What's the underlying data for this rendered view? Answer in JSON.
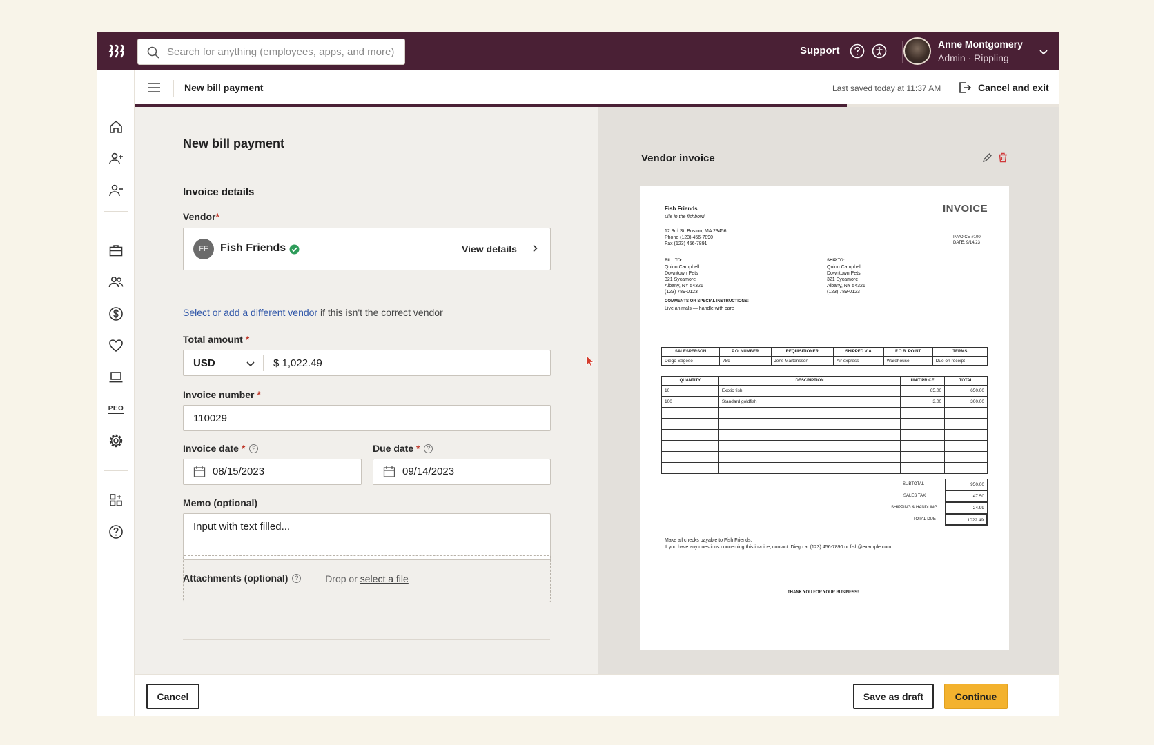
{
  "search": {
    "placeholder": "Search for anything (employees, apps, and more)"
  },
  "topbar": {
    "support_label": "Support",
    "user_name": "Anne Montgomery",
    "user_role": "Admin · Rippling"
  },
  "subheader": {
    "title": "New bill payment",
    "last_saved": "Last saved today at 11:37 AM",
    "cancel_exit": "Cancel and exit",
    "progress": 0.77
  },
  "form": {
    "title": "New bill payment",
    "section_title": "Invoice details",
    "vendor_label": "Vendor",
    "vendor_initials": "FF",
    "vendor_name": "Fish Friends",
    "view_details": "View details",
    "vendor_note_link": "Select or add a different vendor",
    "vendor_note_rest": " if this isn't the correct vendor",
    "total_label": "Total amount",
    "currency": "USD",
    "amount": "$  1,022.49",
    "invoice_number_label": "Invoice number",
    "invoice_number": "110029",
    "invoice_date_label": "Invoice date",
    "invoice_date": "08/15/2023",
    "due_date_label": "Due date",
    "due_date": "09/14/2023",
    "memo_label": "Memo (optional)",
    "memo_value": "Input with text filled...",
    "attachments_label": "Attachments (optional)",
    "drop_text": "Drop or ",
    "select_file": "select a file"
  },
  "invoice_panel": {
    "title": "Vendor invoice",
    "doc": {
      "company": "Fish Friends",
      "tagline": "Life in the fishbowl",
      "address": "12 3rd St, Boston, MA 23456",
      "phone": "Phone (123) 456-7890",
      "fax": "Fax (123) 456-7891",
      "title": "INVOICE",
      "invoice_no": "INVOICE #100",
      "date": "DATE: 9/14/23",
      "bill_to_label": "BILL TO:",
      "bill_to": [
        "Quinn Campbell",
        "Downtown Pets",
        "321 Sycamore",
        "Albany, NY 54321",
        "(123) 789-0123"
      ],
      "ship_to_label": "SHIP TO:",
      "ship_to": [
        "Quinn Campbell",
        "Downtown Pets",
        "321 Sycamore",
        "Albany, NY 54321",
        "(123) 789-0123"
      ],
      "comments_label": "COMMENTS OR SPECIAL INSTRUCTIONS:",
      "comments": "Live animals — handle with care",
      "meta_headers": [
        "SALESPERSON",
        "P.O. NUMBER",
        "REQUISITIONER",
        "SHIPPED VIA",
        "F.O.B. POINT",
        "TERMS"
      ],
      "meta_values": [
        "Diego Sagese",
        "789",
        "Jens Martensson",
        "Air express",
        "Warehouse",
        "Due on receipt"
      ],
      "item_headers": [
        "QUANTITY",
        "DESCRIPTION",
        "UNIT PRICE",
        "TOTAL"
      ],
      "items": [
        [
          "10",
          "Exotic fish",
          "65.00",
          "650.00"
        ],
        [
          "100",
          "Standard goldfish",
          "3.00",
          "300.00"
        ],
        [
          "",
          "",
          "",
          ""
        ],
        [
          "",
          "",
          "",
          ""
        ],
        [
          "",
          "",
          "",
          ""
        ],
        [
          "",
          "",
          "",
          ""
        ],
        [
          "",
          "",
          "",
          ""
        ],
        [
          "",
          "",
          "",
          ""
        ]
      ],
      "subtotal_label": "SUBTOTAL",
      "subtotal": "950.00",
      "tax_label": "SALES TAX",
      "tax": "47.50",
      "shipping_label": "SHIPPING & HANDLING",
      "shipping": "24.99",
      "total_label": "TOTAL DUE",
      "total": "1022.49",
      "note1": "Make all checks payable to Fish Friends.",
      "note2": "If you have any questions concerning this invoice, contact:  Diego at (123) 456-7890  or fish@example.com.",
      "thanks": "THANK YOU FOR YOUR BUSINESS!"
    }
  },
  "footer": {
    "cancel": "Cancel",
    "save_draft": "Save as draft",
    "continue": "Continue"
  },
  "colors": {
    "brand": "#4a2035",
    "primary_button": "#f3b22e",
    "link": "#2f56a8",
    "verified": "#2e9c5a",
    "delete": "#d0393b"
  }
}
